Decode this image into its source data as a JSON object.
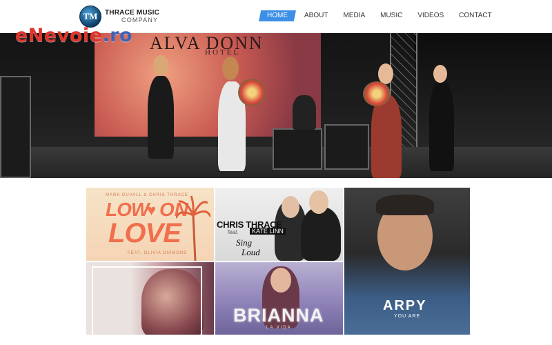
{
  "header": {
    "logo_mark": "TM",
    "logo_line1": "THRACE MUSIC",
    "logo_line2": "COMPANY"
  },
  "nav": {
    "items": [
      {
        "label": "HOME",
        "active": true
      },
      {
        "label": "ABOUT",
        "active": false
      },
      {
        "label": "MEDIA",
        "active": false
      },
      {
        "label": "MUSIC",
        "active": false
      },
      {
        "label": "VIDEOS",
        "active": false
      },
      {
        "label": "CONTACT",
        "active": false
      }
    ],
    "active_color": "#3b8fe6"
  },
  "watermark": {
    "part1": "eNevoie",
    "part2": ".ro"
  },
  "hero": {
    "screen_text": "ALVA DONN",
    "screen_sub": "HOTEL"
  },
  "covers": [
    {
      "credit": "MARK DUVALL & CHRIS THRACE",
      "title_a": "LOW",
      "title_b": "ON",
      "title_c": "LOVE",
      "feat": "FEAT. OLIVIA DIAMOND"
    },
    {
      "artist": "CHRIS THRACE",
      "feat": "feat.",
      "featuring": "KATE LINN",
      "title_a": "Sing",
      "title_b": "Loud"
    },
    {
      "title": "ARPY",
      "subtitle": "YOU ARE"
    },
    {},
    {
      "title": "BRIANNA",
      "subtitle": "LA VIDA"
    }
  ]
}
